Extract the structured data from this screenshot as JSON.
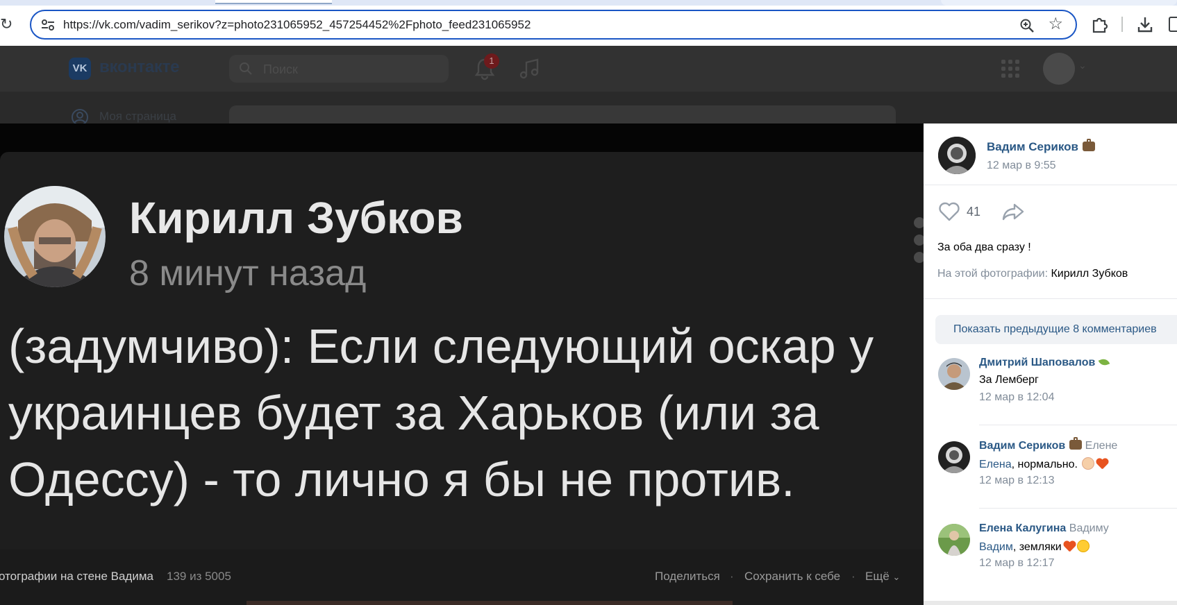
{
  "browser": {
    "url": "https://vk.com/vadim_serikov?z=photo231065952_457254452%2Fphoto_feed231065952"
  },
  "vk_header": {
    "logo_text": "вконтакте",
    "logo_letters": "VK",
    "search_placeholder": "Поиск",
    "notifications_count": "1"
  },
  "left_nav": {
    "my_page": "Моя страница"
  },
  "photo": {
    "author": "Кирилл Зубков",
    "time": "8 минут назад",
    "text": "(задумчиво): Если следующий оскар у украинцев будет за Харьков (или за Одессу) - то лично я бы не против."
  },
  "viewer_bottom": {
    "album": "отографии на стене Вадима",
    "counter": "139 из 5005",
    "share": "Поделиться",
    "save": "Сохранить к себе",
    "more": "Ещё",
    "dot": "·"
  },
  "panel": {
    "owner_name": "Вадим Сериков",
    "owner_date": "12 мар в 9:55",
    "likes": "41",
    "description": "За оба два сразу !",
    "on_photo_label": "На этой фотографии:",
    "on_photo_name": "Кирилл Зубков",
    "show_previous": "Показать предыдущие 8 комментариев",
    "comments": [
      {
        "author": "Дмитрий Шаповалов",
        "reply_to": "",
        "mention": "",
        "text": "За Лемберг",
        "date": "12 мар в 12:04"
      },
      {
        "author": "Вадим Сериков",
        "reply_to": "Елене",
        "mention": "Елена",
        "text": ", нормально.",
        "date": "12 мар в 12:13"
      },
      {
        "author": "Елена Калугина",
        "reply_to": "Вадиму",
        "mention": "Вадим",
        "text": ", земляки",
        "date": "12 мар в 12:17"
      }
    ]
  },
  "colors": {
    "vk_link": "#2a5885",
    "secondary_text": "#818c99",
    "omnibox_border": "#1a56c5"
  }
}
